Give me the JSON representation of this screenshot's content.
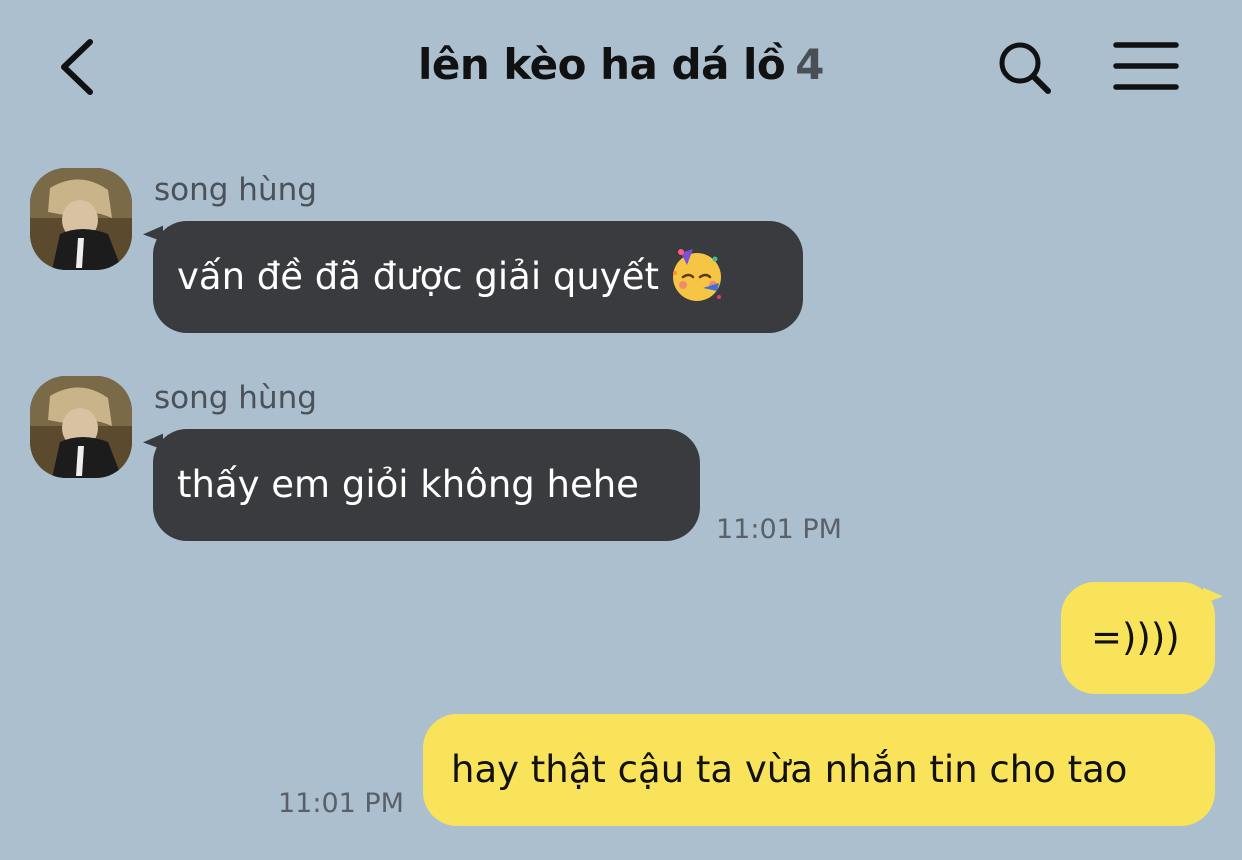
{
  "header": {
    "title": "lên kèo ha dá lồ",
    "member_count": "4",
    "back_icon": "chevron-left-icon",
    "search_icon": "search-icon",
    "menu_icon": "hamburger-menu-icon"
  },
  "messages": [
    {
      "direction": "incoming",
      "sender": "song hùng",
      "text": "vấn đề đã được giải quyết",
      "emoji": "partying-face-emoji",
      "time": ""
    },
    {
      "direction": "incoming",
      "sender": "song hùng",
      "text": "thấy em giỏi không hehe",
      "time": "11:01 PM"
    },
    {
      "direction": "outgoing",
      "text": "=))))",
      "time": ""
    },
    {
      "direction": "outgoing",
      "text": "hay thật cậu ta vừa nhắn tin cho tao",
      "time": "11:01 PM"
    }
  ],
  "colors": {
    "background": "#abbfcf",
    "incoming_bubble": "#3a3b3e",
    "outgoing_bubble": "#f8e35a",
    "sender_text": "#4b5158",
    "timestamp_text": "#5a6068"
  }
}
